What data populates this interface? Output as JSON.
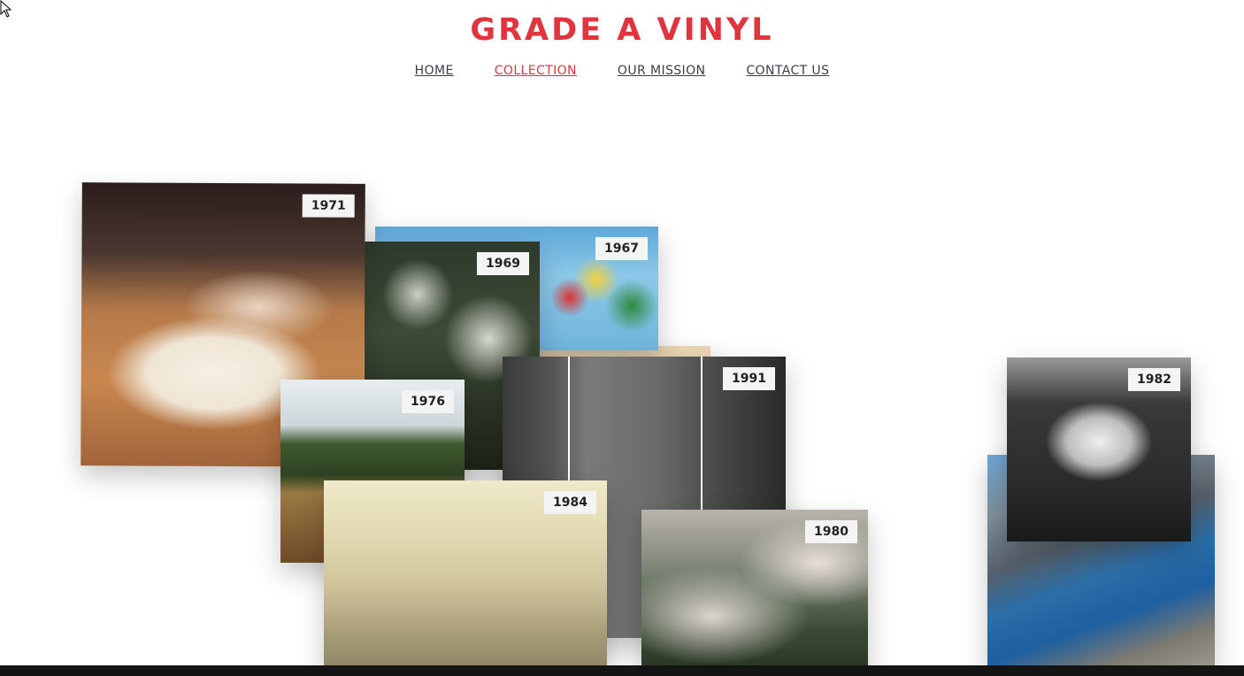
{
  "brand": "GRADE A VINYL",
  "nav": {
    "home": "HOME",
    "collection": "COLLECTION",
    "mission": "OUR MISSION",
    "contact": "CONTACT US"
  },
  "colors": {
    "accent": "#e0353f",
    "nav_text": "#3b3f4a",
    "footer": "#141414"
  },
  "albums": {
    "y1971": "1971",
    "y1967": "1967",
    "y1969": "1969",
    "y1976": "1976",
    "y1991": "1991",
    "y1984": "1984",
    "y1980": "1980",
    "y1982": "1982"
  }
}
